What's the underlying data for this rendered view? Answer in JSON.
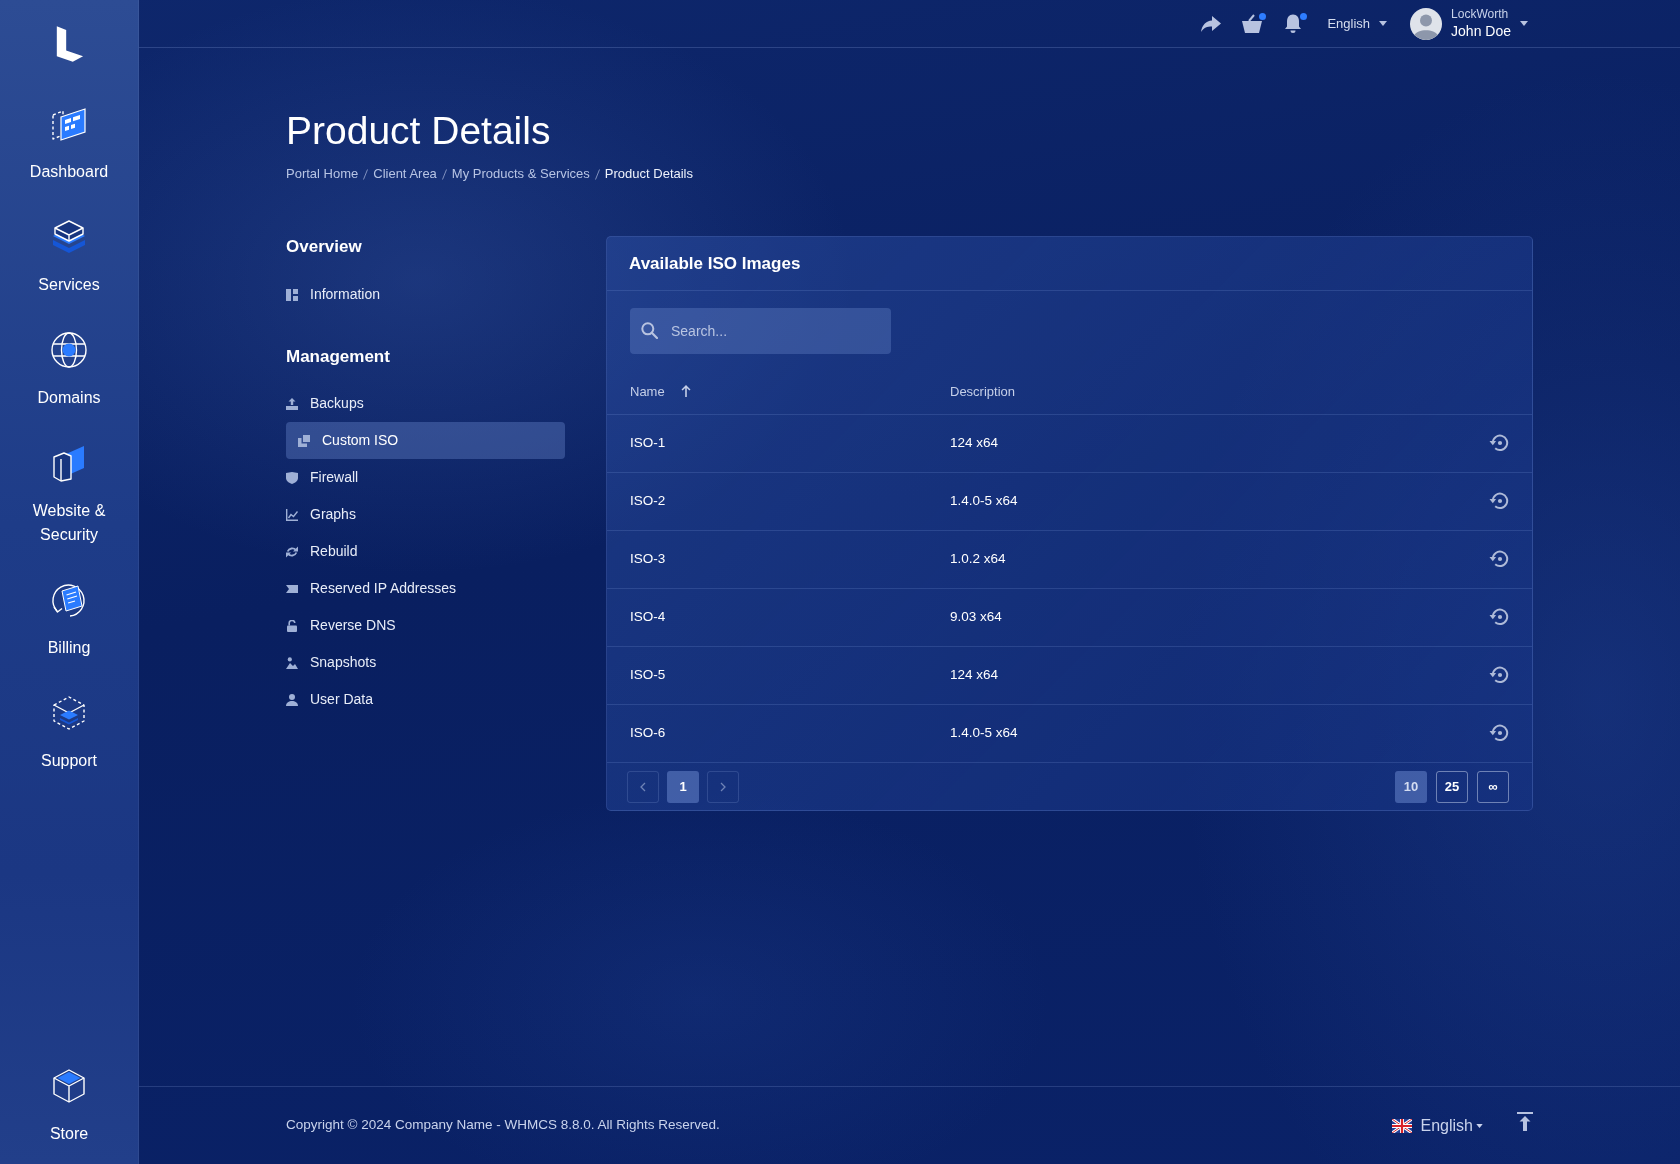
{
  "sidebar": {
    "items": [
      {
        "label": "Dashboard"
      },
      {
        "label": "Services"
      },
      {
        "label": "Domains"
      },
      {
        "label": "Website & Security"
      },
      {
        "label": "Billing"
      },
      {
        "label": "Support"
      }
    ],
    "bottom_item": {
      "label": "Store"
    }
  },
  "top_bar": {
    "actions": [
      {
        "kind": "share",
        "unread": false
      },
      {
        "kind": "cart",
        "unread": true
      },
      {
        "kind": "bell",
        "unread": true
      }
    ],
    "language": "English",
    "user": {
      "company": "LockWorth",
      "name": "John Doe"
    }
  },
  "page": {
    "title": "Product Details",
    "breadcrumb": [
      {
        "label": "Portal Home",
        "current": false
      },
      {
        "label": "Client Area",
        "current": false
      },
      {
        "label": "My Products & Services",
        "current": false
      },
      {
        "label": "Product Details",
        "current": true
      }
    ]
  },
  "menu": {
    "sections": [
      {
        "title": "Overview",
        "items": [
          {
            "label": "Information",
            "selected": false
          }
        ]
      },
      {
        "title": "Management",
        "items": [
          {
            "label": "Backups",
            "selected": false
          },
          {
            "label": "Custom ISO",
            "selected": true
          },
          {
            "label": "Firewall",
            "selected": false
          },
          {
            "label": "Graphs",
            "selected": false
          },
          {
            "label": "Rebuild",
            "selected": false
          },
          {
            "label": "Reserved IP Addresses",
            "selected": false
          },
          {
            "label": "Reverse DNS",
            "selected": false
          },
          {
            "label": "Snapshots",
            "selected": false
          },
          {
            "label": "User Data",
            "selected": false
          }
        ]
      }
    ]
  },
  "panel": {
    "title": "Available ISO Images",
    "search": {
      "placeholder": "Search..."
    },
    "columns": [
      {
        "label": "Name",
        "sorted": true
      },
      {
        "label": "Description",
        "sorted": false
      }
    ],
    "rows": [
      {
        "name": "ISO-1",
        "description": "124 x64"
      },
      {
        "name": "ISO-2",
        "description": "1.4.0-5 x64"
      },
      {
        "name": "ISO-3",
        "description": "1.0.2 x64"
      },
      {
        "name": "ISO-4",
        "description": "9.03 x64"
      },
      {
        "name": "ISO-5",
        "description": "124 x64"
      },
      {
        "name": "ISO-6",
        "description": "1.4.0-5 x64"
      }
    ],
    "pagination": {
      "previous": {
        "disabled": true
      },
      "pages": [
        {
          "label": "1",
          "selected": true
        }
      ],
      "next": {
        "disabled": true
      },
      "page_sizes": [
        {
          "label": "10",
          "selected": true
        },
        {
          "label": "25",
          "selected": false
        },
        {
          "label": "∞",
          "selected": false
        }
      ]
    }
  },
  "footer": {
    "copyright": "Copyright © 2024 Company Name - WHMCS 8.8.0. All Rights Reserved.",
    "language": "English"
  }
}
